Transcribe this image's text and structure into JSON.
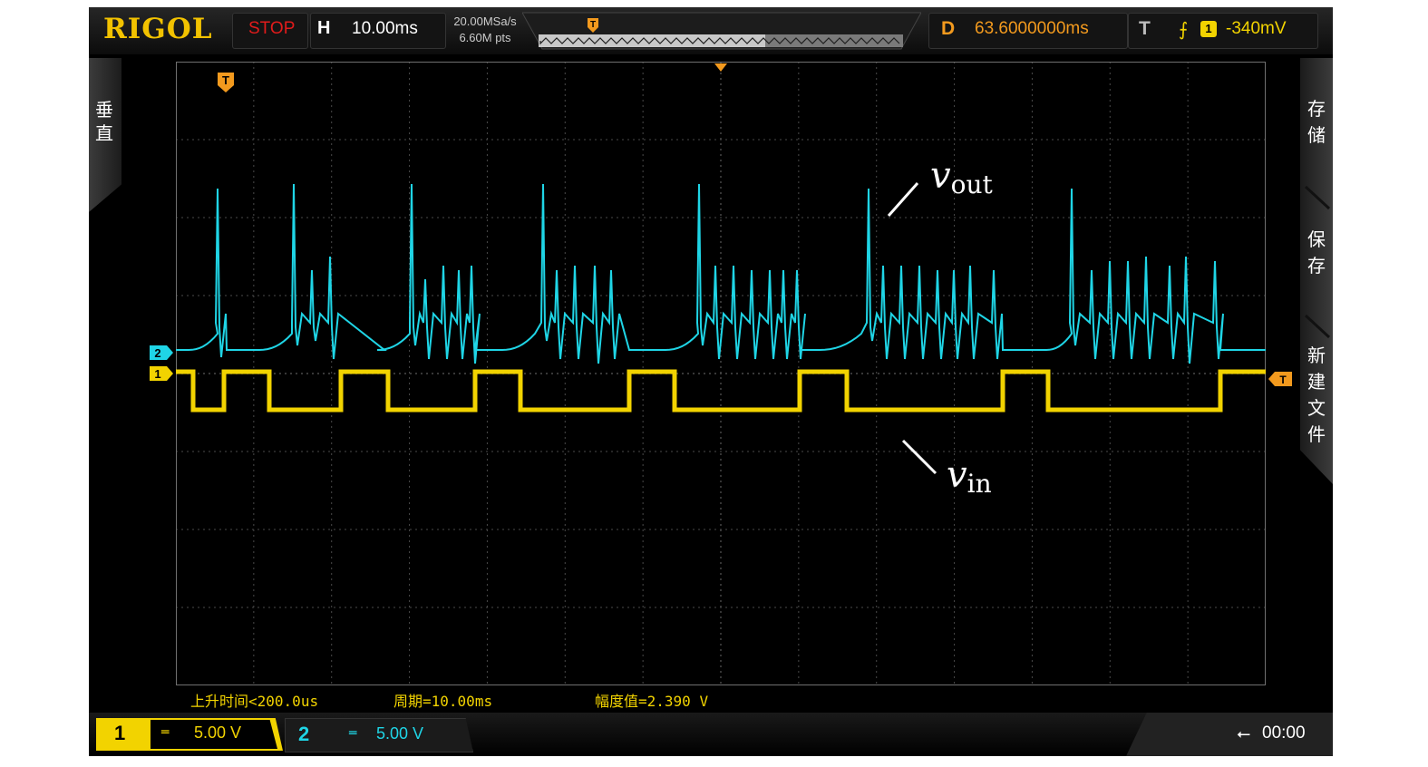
{
  "header": {
    "brand": "RIGOL",
    "run_state": "STOP",
    "horizontal_label": "H",
    "timebase": "10.00ms",
    "sample_rate": "20.00MSa/s",
    "memory_depth": "6.60M pts",
    "memory_marker": "T",
    "delay_label": "D",
    "delay_value": "63.6000000ms",
    "trigger_label": "T",
    "trigger_source": "1",
    "trigger_level": "-340mV"
  },
  "left_menu": {
    "label": "垂直"
  },
  "right_menu": {
    "items": [
      "存储",
      "保存",
      "新建文件"
    ]
  },
  "screen": {
    "trigger_pos_marker": "T",
    "ch2_marker": "2",
    "ch1_marker": "1",
    "trig_level_marker": "T",
    "annotations": {
      "vout": "v",
      "vout_sub": "out",
      "vin": "v",
      "vin_sub": "in"
    }
  },
  "measurements": [
    {
      "label": "上升时间",
      "value": "<200.0us"
    },
    {
      "label": "周期",
      "value": "=10.00ms"
    },
    {
      "label": "幅度值",
      "value": "=2.390 V"
    }
  ],
  "footer": {
    "ch1": {
      "number": "1",
      "coupling": "═",
      "scale": "5.00 V"
    },
    "ch2": {
      "number": "2",
      "coupling": "═",
      "scale": "5.00 V"
    },
    "usb_icon": "usb-icon",
    "time": "00:00"
  },
  "colors": {
    "ch1": "#f2d300",
    "ch2": "#1fd5e6",
    "trigger": "#f39a1e",
    "grid": "#4a4a4a",
    "stop": "#e11b1b"
  }
}
